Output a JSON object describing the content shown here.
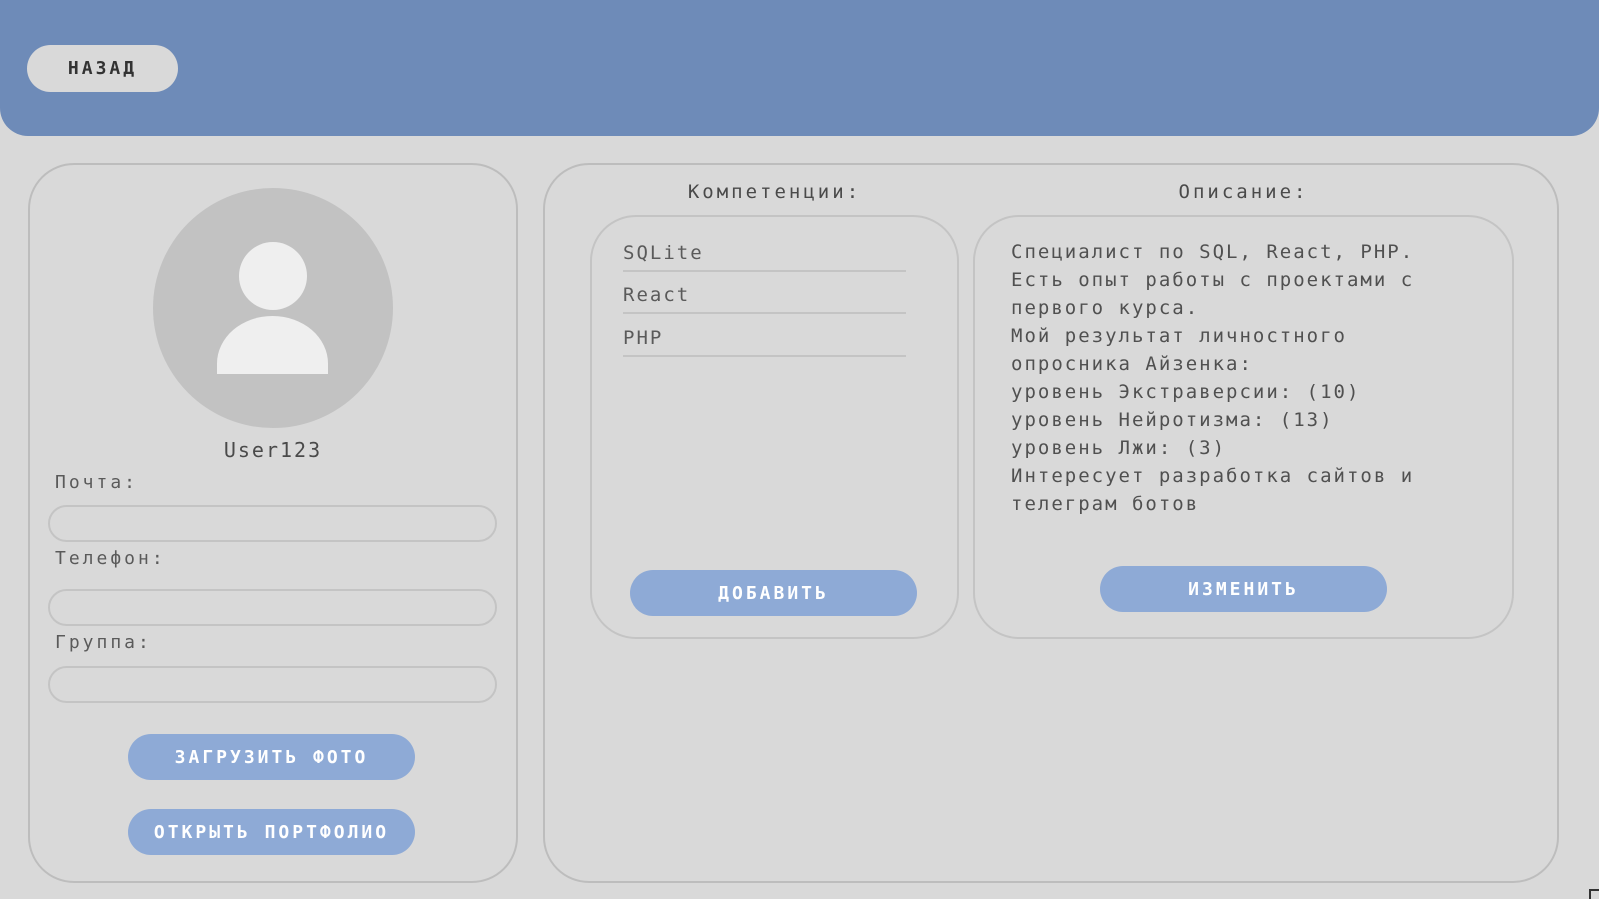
{
  "header": {
    "back_label": "НАЗАД"
  },
  "profile": {
    "username": "User123",
    "fields": [
      {
        "label": "Почта:",
        "value": ""
      },
      {
        "label": "Телефон:",
        "value": ""
      },
      {
        "label": "Группа:",
        "value": ""
      }
    ],
    "upload_photo_label": "ЗАГРУЗИТЬ ФОТО",
    "open_portfolio_label": "ОТКРЫТЬ ПОРТФОЛИО"
  },
  "competencies": {
    "title": "Компетенции:",
    "items": [
      "SQLite",
      "React",
      "PHP"
    ],
    "add_label": "ДОБАВИТЬ"
  },
  "description": {
    "title": "Описание:",
    "lines": [
      "Специалист по SQL, React, PHP.",
      "Есть опыт работы с проектами с",
      "первого курса.",
      "Мой результат личностного",
      "опросника Айзенка:",
      "уровень Экстраверсии: (10)",
      "уровень Нейротизма: (13)",
      "уровень Лжи: (3)",
      "Интересует разработка сайтов и",
      "телеграм ботов"
    ],
    "edit_label": "ИЗМЕНИТЬ"
  },
  "colors": {
    "background": "#d9d9d9",
    "header": "#6e8bb8",
    "button": "#8eaad6",
    "avatar": "#c2c2c2"
  }
}
